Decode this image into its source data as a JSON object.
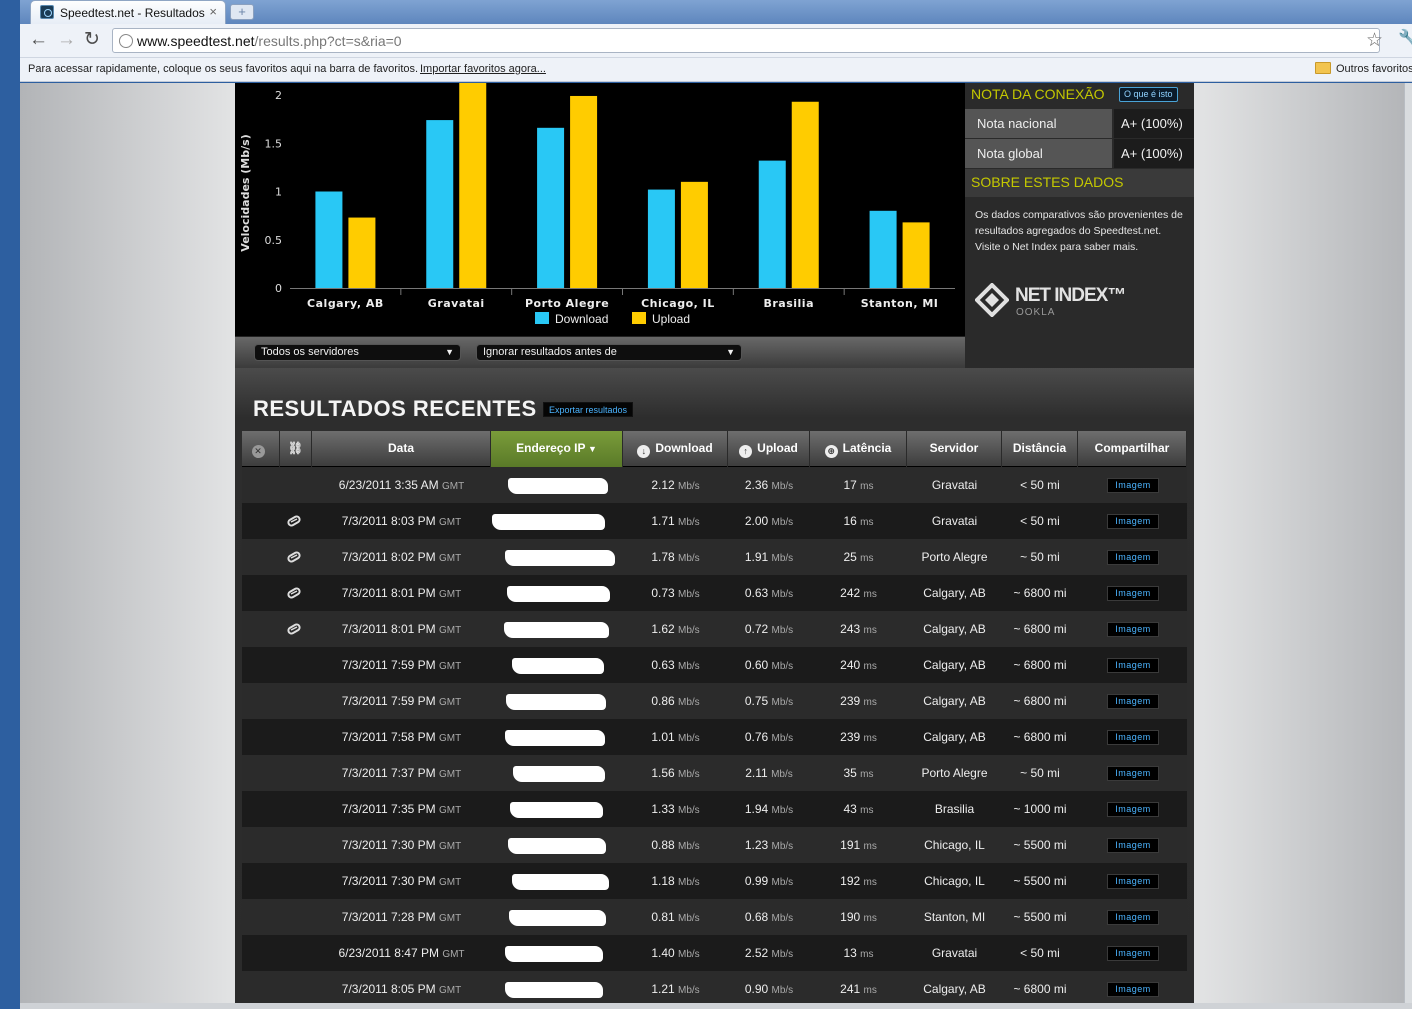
{
  "browser": {
    "tab_title": "Speedtest.net - Resultados",
    "tab_close": "×",
    "new_tab": "+",
    "url_host": "www.speedtest.net",
    "url_rest": "/results.php?ct=s&ria=0",
    "bookmarks_hint": "Para acessar rapidamente, coloque os seus favoritos aqui na barra de favoritos.",
    "bookmarks_import": "Importar favoritos agora...",
    "other_bookmarks": "Outros favoritos"
  },
  "chart_data": {
    "type": "bar",
    "categories": [
      "Calgary, AB",
      "Gravatai",
      "Porto Alegre",
      "Chicago, IL",
      "Brasilia",
      "Stanton, MI"
    ],
    "series": [
      {
        "name": "Download",
        "values": [
          1.0,
          1.74,
          1.66,
          1.02,
          1.32,
          0.8
        ],
        "color": "#29c8f5"
      },
      {
        "name": "Upload",
        "values": [
          0.73,
          2.13,
          1.99,
          1.1,
          1.93,
          0.68
        ],
        "color": "#ffcc00"
      }
    ],
    "ylabel": "Velocidades (Mb/s)",
    "yticks": [
      "0",
      "0.5",
      "1",
      "1.5",
      "2"
    ],
    "ylim": [
      0,
      2
    ],
    "legend": "bottom"
  },
  "filters": {
    "servers": "Todos os servidores",
    "ignore": "Ignorar resultados antes de"
  },
  "rating": {
    "title": "NOTA DA CONEXÃO",
    "what_button": "O que é isto",
    "national_label": "Nota nacional",
    "national_value": "A+ (100%)",
    "global_label": "Nota global",
    "global_value": "A+ (100%)"
  },
  "about": {
    "title": "SOBRE ESTES DADOS",
    "text": "Os dados comparativos são provenientes de resultados agregados do Speedtest.net. Visite o Net Index para saber mais.",
    "logo_main": "NET INDEX™",
    "logo_sub": "OOKLA"
  },
  "recent": {
    "title": "RESULTADOS RECENTES",
    "export_button": "Exportar resultados",
    "headers": {
      "date": "Data",
      "ip": "Endereço IP",
      "download": "Download",
      "upload": "Upload",
      "latency": "Latência",
      "server": "Servidor",
      "distance": "Distância",
      "share": "Compartilhar"
    },
    "share_label": "Imagem",
    "units": {
      "speed": "Mb/s",
      "latency": "ms",
      "tz": "GMT"
    },
    "rows": [
      {
        "date": "6/23/2011 3:35 AM",
        "download": "2.12",
        "upload": "2.36",
        "latency": "17",
        "server": "Gravatai",
        "distance": "< 50 mi",
        "attach": false
      },
      {
        "date": "7/3/2011 8:03 PM",
        "download": "1.71",
        "upload": "2.00",
        "latency": "16",
        "server": "Gravatai",
        "distance": "< 50 mi",
        "attach": true
      },
      {
        "date": "7/3/2011 8:02 PM",
        "download": "1.78",
        "upload": "1.91",
        "latency": "25",
        "server": "Porto Alegre",
        "distance": "~ 50 mi",
        "attach": true
      },
      {
        "date": "7/3/2011 8:01 PM",
        "download": "0.73",
        "upload": "0.63",
        "latency": "242",
        "server": "Calgary, AB",
        "distance": "~ 6800 mi",
        "attach": true
      },
      {
        "date": "7/3/2011 8:01 PM",
        "download": "1.62",
        "upload": "0.72",
        "latency": "243",
        "server": "Calgary, AB",
        "distance": "~ 6800 mi",
        "attach": true
      },
      {
        "date": "7/3/2011 7:59 PM",
        "download": "0.63",
        "upload": "0.60",
        "latency": "240",
        "server": "Calgary, AB",
        "distance": "~ 6800 mi",
        "attach": false
      },
      {
        "date": "7/3/2011 7:59 PM",
        "download": "0.86",
        "upload": "0.75",
        "latency": "239",
        "server": "Calgary, AB",
        "distance": "~ 6800 mi",
        "attach": false
      },
      {
        "date": "7/3/2011 7:58 PM",
        "download": "1.01",
        "upload": "0.76",
        "latency": "239",
        "server": "Calgary, AB",
        "distance": "~ 6800 mi",
        "attach": false
      },
      {
        "date": "7/3/2011 7:37 PM",
        "download": "1.56",
        "upload": "2.11",
        "latency": "35",
        "server": "Porto Alegre",
        "distance": "~ 50 mi",
        "attach": false
      },
      {
        "date": "7/3/2011 7:35 PM",
        "download": "1.33",
        "upload": "1.94",
        "latency": "43",
        "server": "Brasilia",
        "distance": "~ 1000 mi",
        "attach": false
      },
      {
        "date": "7/3/2011 7:30 PM",
        "download": "0.88",
        "upload": "1.23",
        "latency": "191",
        "server": "Chicago, IL",
        "distance": "~ 5500 mi",
        "attach": false
      },
      {
        "date": "7/3/2011 7:30 PM",
        "download": "1.18",
        "upload": "0.99",
        "latency": "192",
        "server": "Chicago, IL",
        "distance": "~ 5500 mi",
        "attach": false
      },
      {
        "date": "7/3/2011 7:28 PM",
        "download": "0.81",
        "upload": "0.68",
        "latency": "190",
        "server": "Stanton, MI",
        "distance": "~ 5500 mi",
        "attach": false
      },
      {
        "date": "6/23/2011 8:47 PM",
        "download": "1.40",
        "upload": "2.52",
        "latency": "13",
        "server": "Gravatai",
        "distance": "< 50 mi",
        "attach": false
      },
      {
        "date": "7/3/2011 8:05 PM",
        "download": "1.21",
        "upload": "0.90",
        "latency": "241",
        "server": "Calgary, AB",
        "distance": "~ 6800 mi",
        "attach": false
      }
    ]
  }
}
